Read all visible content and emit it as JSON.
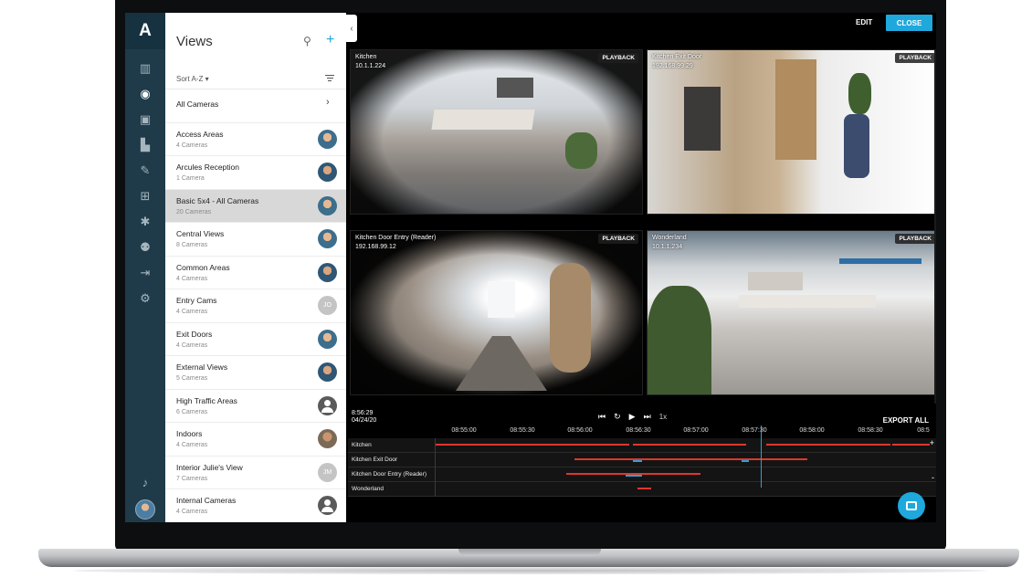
{
  "app": {
    "logo": "A",
    "brand_color": "#1fa8dc",
    "rail_color": "#1f3b4a"
  },
  "rail": {
    "icons": [
      "bar-chart-icon",
      "eye-icon",
      "lock-icon",
      "building-icon",
      "wrench-icon",
      "network-icon",
      "alarm-icon",
      "people-icon",
      "door-exit-icon",
      "gear-icon",
      "bell-icon",
      "user-avatar"
    ]
  },
  "views_panel": {
    "title": "Views",
    "sort_label": "Sort A-Z",
    "all_cameras": "All Cameras",
    "items": [
      {
        "name": "Access Areas",
        "count": "4 Cameras",
        "avatar": "face"
      },
      {
        "name": "Arcules Reception",
        "count": "1 Camera",
        "avatar": "face2"
      },
      {
        "name": "Basic 5x4 - All Cameras",
        "count": "20 Cameras",
        "avatar": "face",
        "selected": true
      },
      {
        "name": "Central Views",
        "count": "8 Cameras",
        "avatar": "face"
      },
      {
        "name": "Common Areas",
        "count": "4 Cameras",
        "avatar": "face2"
      },
      {
        "name": "Entry Cams",
        "count": "4 Cameras",
        "avatar": "initials",
        "initials": "JO"
      },
      {
        "name": "Exit Doors",
        "count": "4 Cameras",
        "avatar": "face"
      },
      {
        "name": "External Views",
        "count": "5 Cameras",
        "avatar": "face2"
      },
      {
        "name": "High Traffic Areas",
        "count": "6 Cameras",
        "avatar": "generic"
      },
      {
        "name": "Indoors",
        "count": "4 Cameras",
        "avatar": "face3"
      },
      {
        "name": "Interior Julie's View",
        "count": "7 Cameras",
        "avatar": "initials",
        "initials": "JM"
      },
      {
        "name": "Internal Cameras",
        "count": "4 Cameras",
        "avatar": "generic"
      }
    ]
  },
  "toolbar": {
    "edit_label": "EDIT",
    "close_label": "CLOSE"
  },
  "cameras": [
    {
      "name": "Kitchen",
      "ip": "10.1.1.224",
      "badge": "PLAYBACK"
    },
    {
      "name": "Kitchen Exit Door",
      "ip": "192.168.99.29",
      "badge": "PLAYBACK"
    },
    {
      "name": "Kitchen Door Entry (Reader)",
      "ip": "192.168.99.12",
      "badge": "PLAYBACK"
    },
    {
      "name": "Wonderland",
      "ip": "10.1.1.234",
      "badge": "PLAYBACK"
    }
  ],
  "timeline": {
    "current_time": "8:56:29",
    "current_date": "04/24/20",
    "speed": "1x",
    "export_label": "EXPORT ALL",
    "ticks": [
      "08:55:00",
      "08:55:30",
      "08:56:00",
      "08:56:30",
      "08:57:00",
      "08:57:30",
      "08:58:00",
      "08:58:30",
      "08:5"
    ],
    "tracks": [
      {
        "label": "Kitchen"
      },
      {
        "label": "Kitchen Exit Door"
      },
      {
        "label": "Kitchen Door Entry (Reader)"
      },
      {
        "label": "Wonderland"
      }
    ],
    "recording_color": "#e0362c",
    "motion_color": "#26a4db"
  }
}
